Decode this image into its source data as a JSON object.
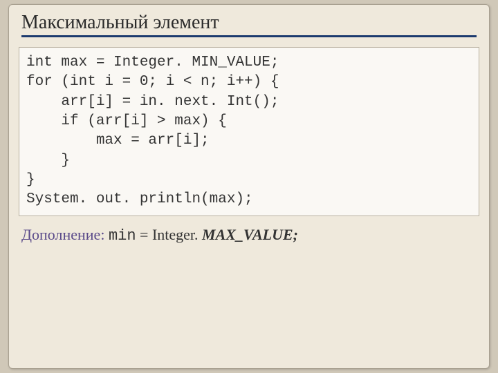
{
  "title": "Максимальный элемент",
  "code": "int max = Integer. MIN_VALUE;\nfor (int i = 0; i < n; i++) {\n    arr[i] = in. next. Int();\n    if (arr[i] > max) {\n        max = arr[i];\n    }\n}\nSystem. out. println(max);",
  "note": {
    "label": "Дополнение:",
    "var": "min",
    "eq": " = Integer. ",
    "tail": "MAX_VALUE;"
  }
}
